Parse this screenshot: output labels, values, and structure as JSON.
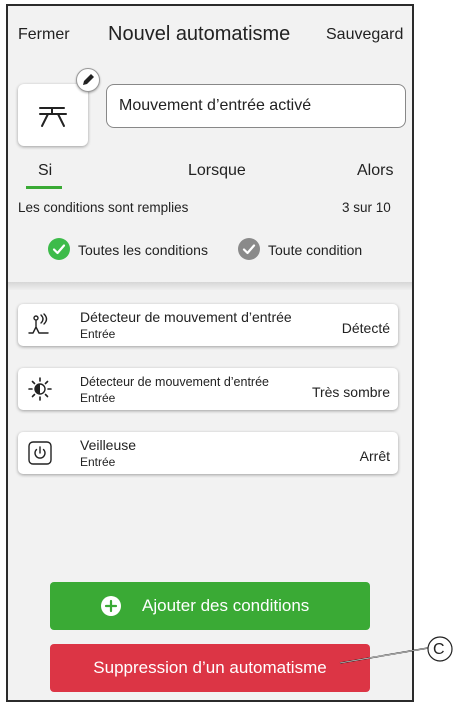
{
  "header": {
    "close_label": "Fermer",
    "title": "Nouvel automatisme",
    "save_label": "Sauvegard"
  },
  "automation": {
    "icon": "automation-icon",
    "edit_icon": "pencil-icon",
    "name_value": "Mouvement d’entrée activé"
  },
  "tabs": [
    {
      "label": "Si",
      "active": true
    },
    {
      "label": "Lorsque",
      "active": false
    },
    {
      "label": "Alors",
      "active": false
    }
  ],
  "conditions": {
    "label": "Les conditions sont remplies",
    "count": "3 sur 10",
    "options": [
      {
        "label": "Toutes les conditions",
        "selected": true
      },
      {
        "label": "Toute condition",
        "selected": false
      }
    ],
    "items": [
      {
        "icon": "motion-sensor-icon",
        "title": "Détecteur de mouvement d’entrée",
        "subtitle": "Entrée",
        "value": "Détecté"
      },
      {
        "icon": "brightness-icon",
        "title": "Détecteur de mouvement d’entrée",
        "subtitle": "Entrée",
        "value": "Très sombre"
      },
      {
        "icon": "power-icon",
        "title": "Veilleuse",
        "subtitle": "Entrée",
        "value": "Arrêt"
      }
    ]
  },
  "actions": {
    "add_label": "Ajouter des conditions",
    "add_icon": "plus-circle-icon",
    "delete_label": "Suppression d’un automatisme"
  },
  "callout": {
    "letter": "C"
  },
  "colors": {
    "accent_green": "#3aaa35",
    "radio_selected": "#3dbb4a",
    "radio_unselected": "#8a8a8a",
    "delete_red": "#dc3545",
    "background": "#f2f2f2"
  }
}
